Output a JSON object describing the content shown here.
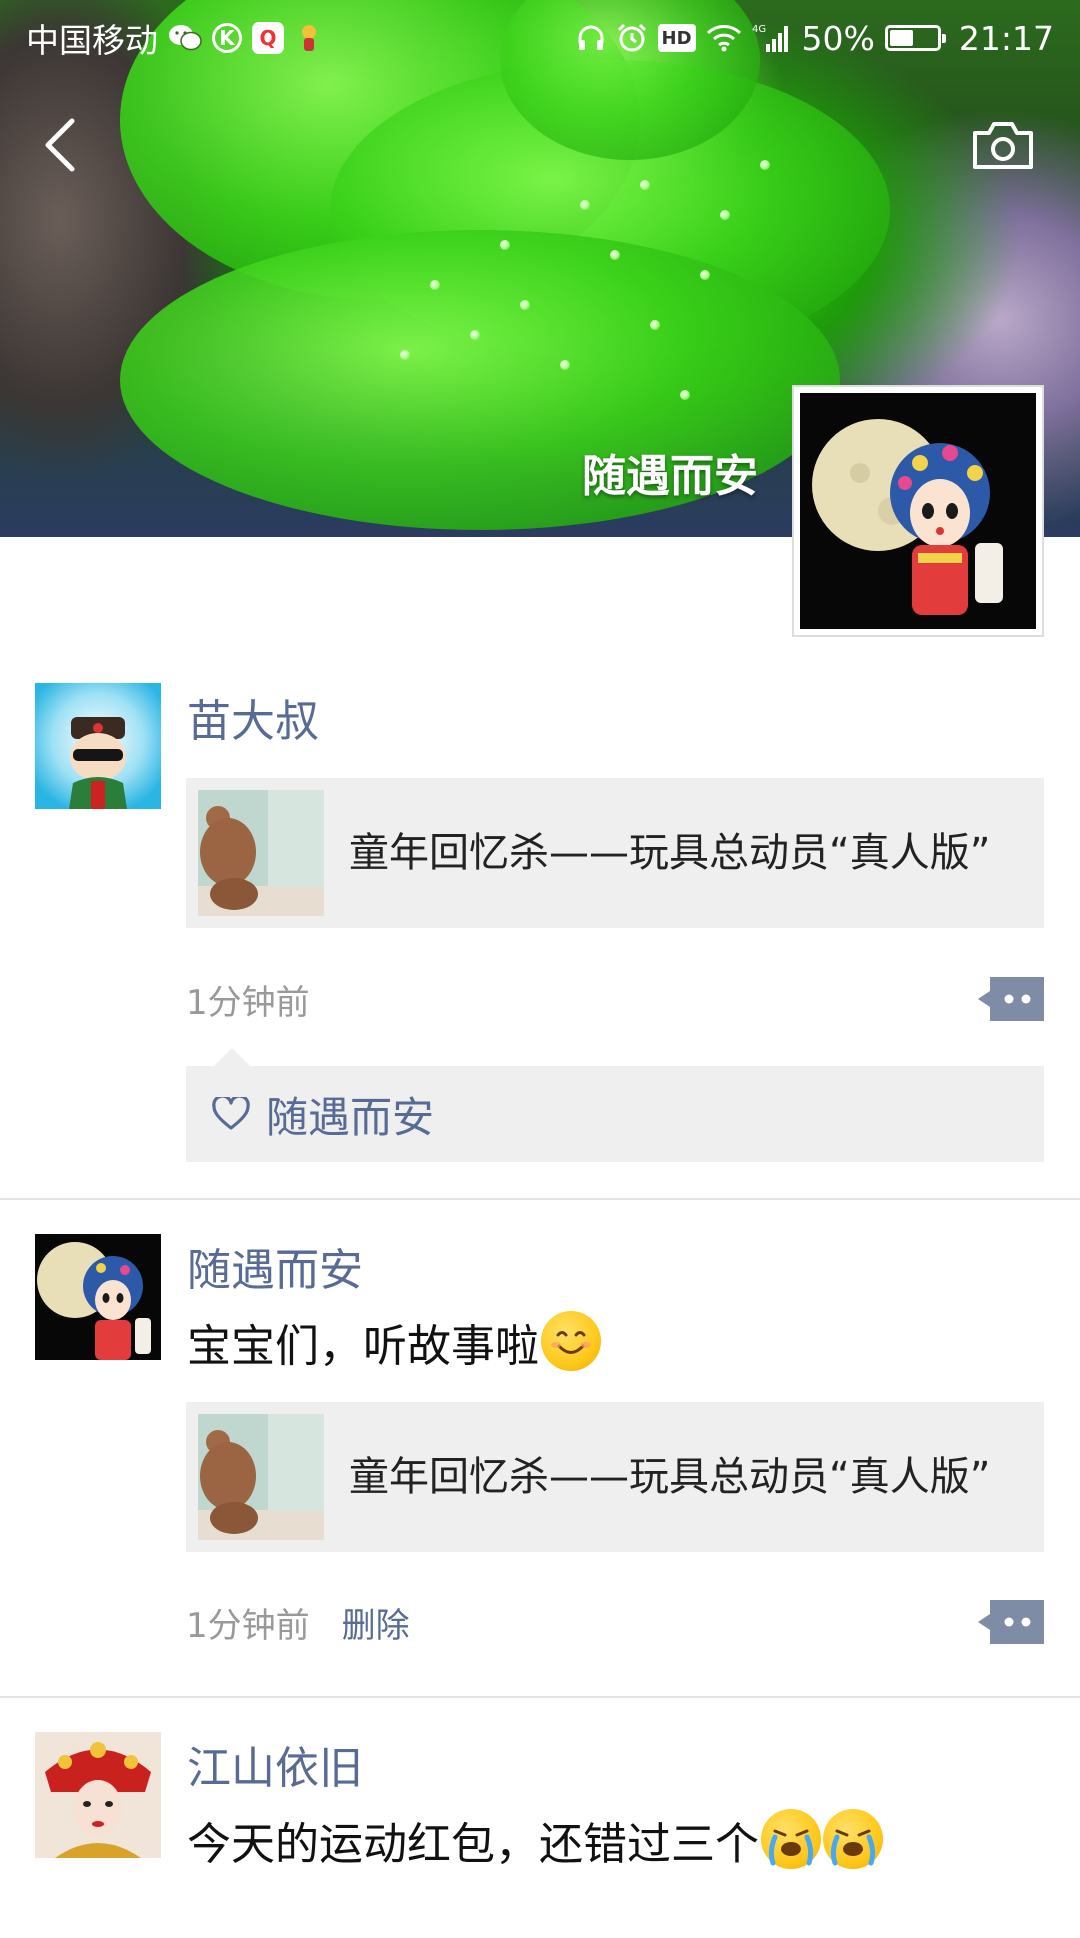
{
  "status_bar": {
    "carrier": "中国移动",
    "network": "4G",
    "battery": "50%",
    "battery_level": 0.5,
    "time": "21:17"
  },
  "header": {
    "username": "随遇而安",
    "back_icon": "chevron-left-icon",
    "camera_icon": "camera-icon"
  },
  "posts": [
    {
      "author": "苗大叔",
      "link_title": "童年回忆杀——玩具总动员“真人版”",
      "time": "1分钟前",
      "likes": [
        "随遇而安"
      ]
    },
    {
      "author": "随遇而安",
      "text": "宝宝们，听故事啦",
      "link_title": "童年回忆杀——玩具总动员“真人版”",
      "time": "1分钟前",
      "delete_label": "删除"
    },
    {
      "author": "江山依旧",
      "text": "今天的运动红包，还错过三个"
    }
  ],
  "colors": {
    "link_blue": "#576b95",
    "card_bg": "#efefef",
    "meta_gray": "#999999"
  }
}
